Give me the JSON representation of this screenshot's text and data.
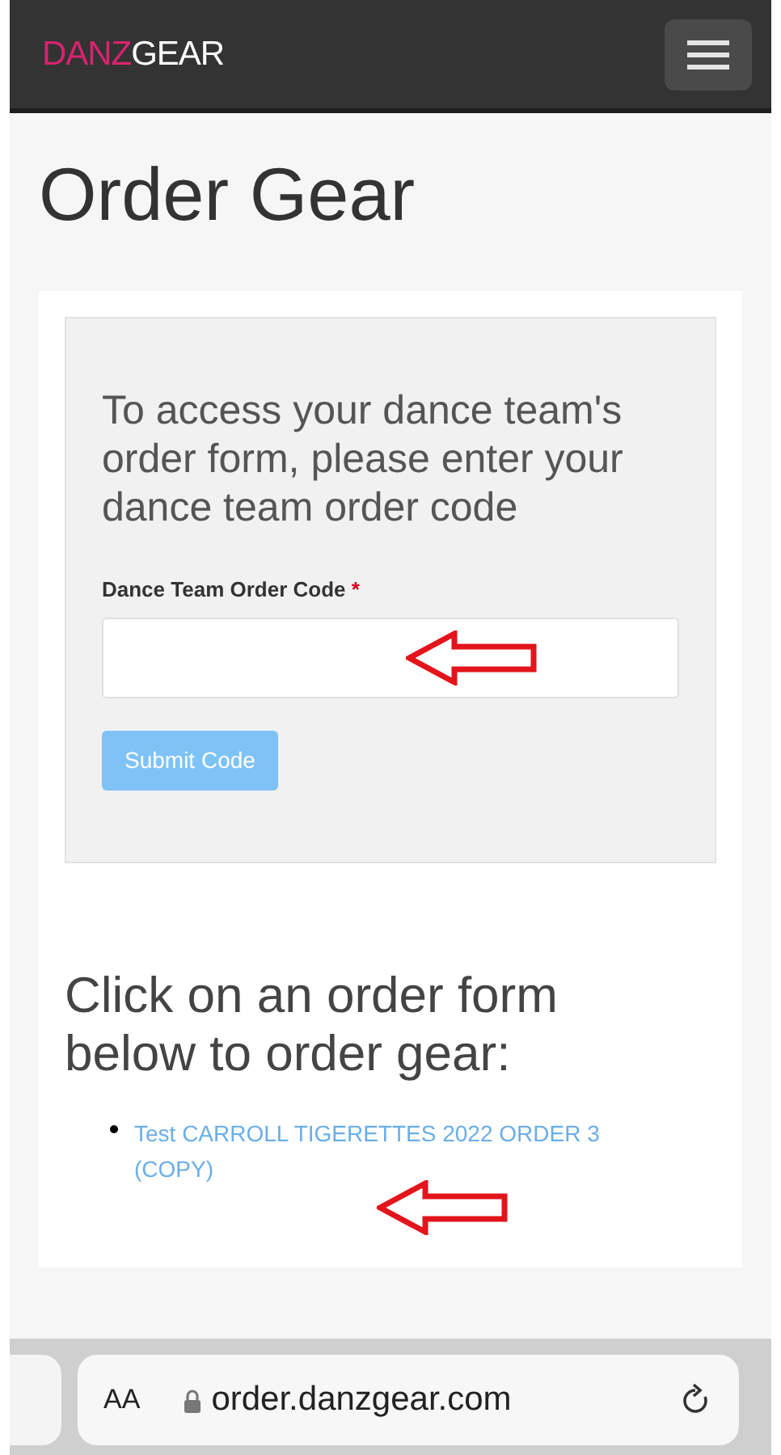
{
  "navbar": {
    "logo_accent": "DANZ",
    "logo_rest": "GEAR"
  },
  "page_title": "Order Gear",
  "code_panel": {
    "intro": "To access your dance team's order form, please enter your dance team order code",
    "field_label": "Dance Team Order Code",
    "required_mark": "*",
    "submit_button": {
      "label": "Submit Code",
      "disabled": true
    }
  },
  "order_forms": {
    "heading": "Click on an order form below to order gear:",
    "links": [
      "Test CARROLL TIGERETTES 2022 ORDER 3 (COPY)"
    ]
  },
  "browser_bar": {
    "text_size_button": "AA",
    "url": "order.danzgear.com"
  }
}
